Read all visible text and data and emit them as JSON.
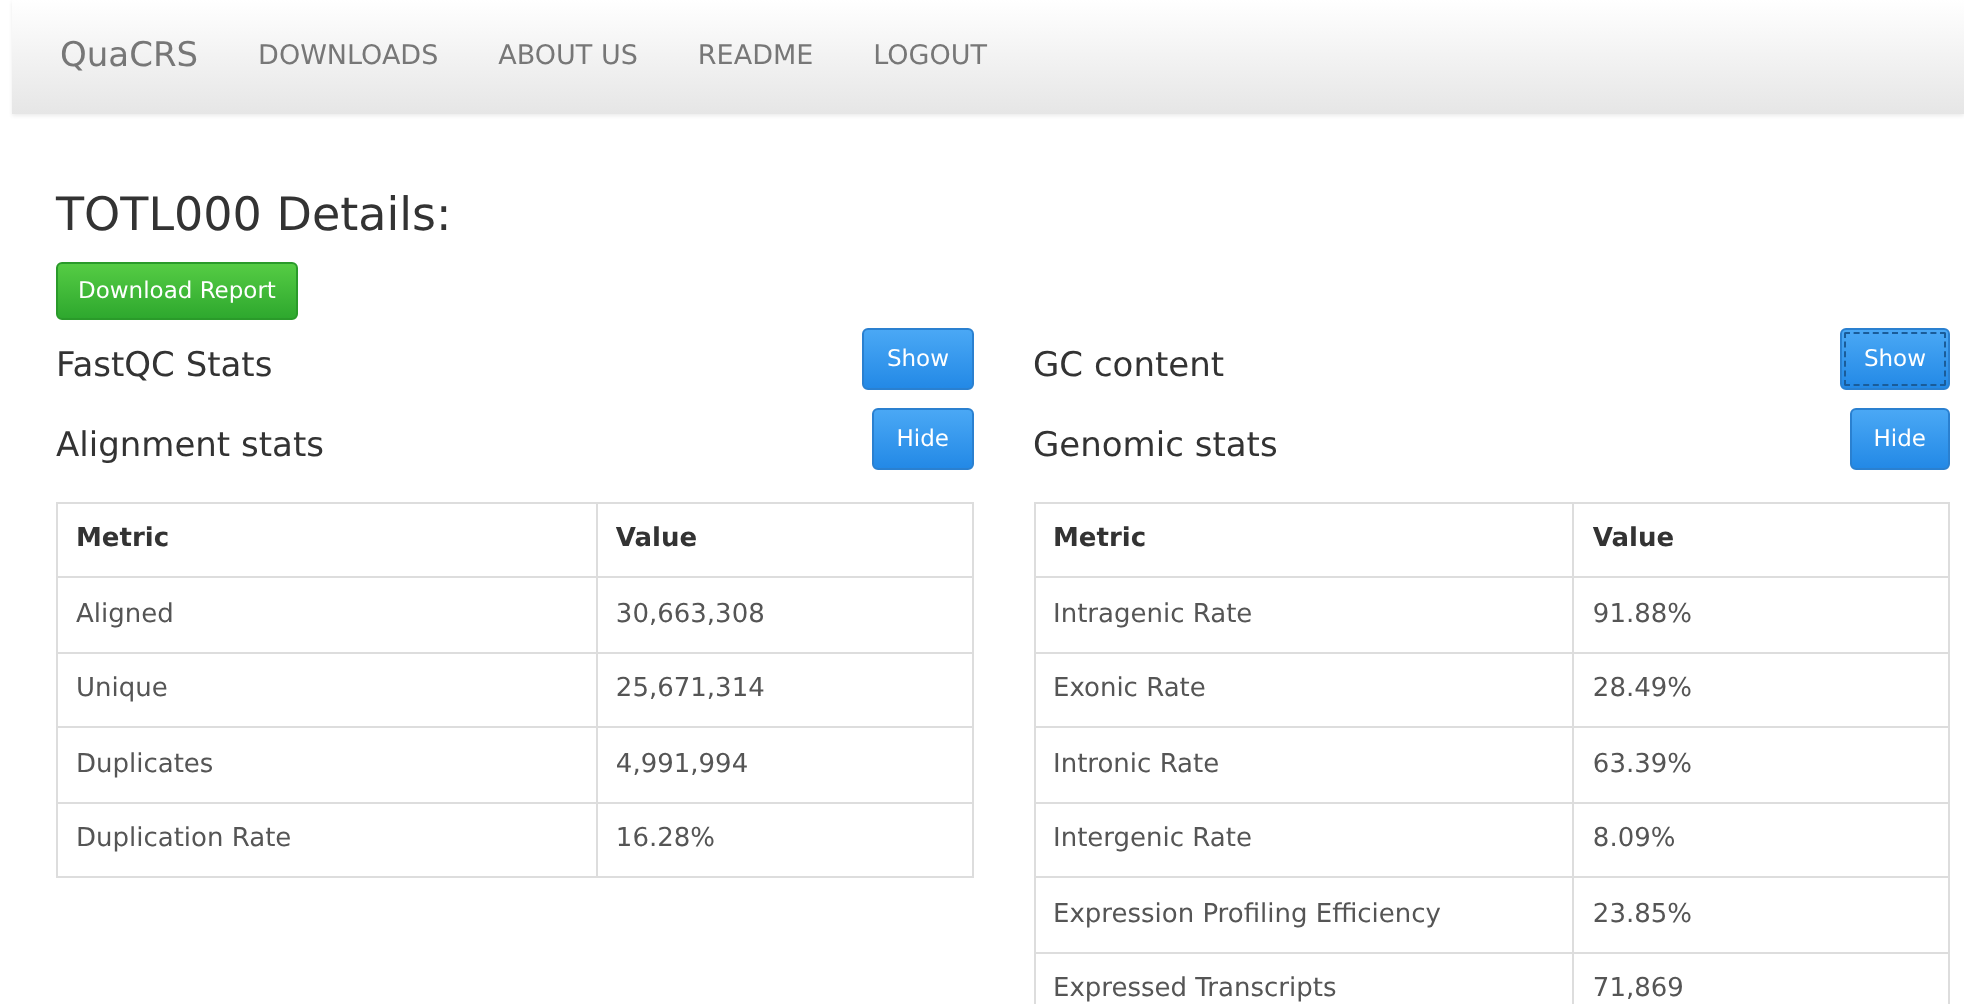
{
  "navbar": {
    "brand": "QuaCRS",
    "links": [
      "DOWNLOADS",
      "ABOUT US",
      "README",
      "LOGOUT"
    ]
  },
  "title": "TOTL000 Details:",
  "download_button": "Download Report",
  "columns": [
    {
      "sections": [
        {
          "heading": "FastQC Stats",
          "button": {
            "label": "Show",
            "focused": false
          }
        },
        {
          "heading": "Alignment stats",
          "button": {
            "label": "Hide",
            "focused": false
          }
        }
      ],
      "table": {
        "columns": [
          "Metric",
          "Value"
        ],
        "rows": [
          [
            "Aligned",
            "30,663,308"
          ],
          [
            "Unique",
            "25,671,314"
          ],
          [
            "Duplicates",
            "4,991,994"
          ],
          [
            "Duplication Rate",
            "16.28%"
          ]
        ]
      }
    },
    {
      "sections": [
        {
          "heading": "GC content",
          "button": {
            "label": "Show",
            "focused": true
          }
        },
        {
          "heading": "Genomic stats",
          "button": {
            "label": "Hide",
            "focused": false
          }
        }
      ],
      "table": {
        "columns": [
          "Metric",
          "Value"
        ],
        "rows": [
          [
            "Intragenic Rate",
            "91.88%"
          ],
          [
            "Exonic Rate",
            "28.49%"
          ],
          [
            "Intronic Rate",
            "63.39%"
          ],
          [
            "Intergenic Rate",
            "8.09%"
          ],
          [
            "Expression Profiling Efficiency",
            "23.85%"
          ],
          [
            "Expressed Transcripts",
            "71,869"
          ]
        ]
      }
    }
  ]
}
